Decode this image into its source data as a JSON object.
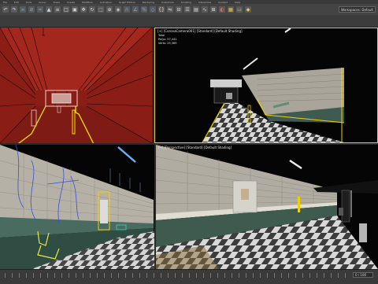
{
  "menu": {
    "items": [
      "File",
      "Edit",
      "Tools",
      "Group",
      "Views",
      "Create",
      "Modifiers",
      "Animation",
      "Graph Editors",
      "Rendering",
      "Customize",
      "Scripting",
      "Interactive",
      "Content",
      "Help"
    ]
  },
  "toolbar": {
    "icons": [
      {
        "name": "undo-icon",
        "glyph": "↶",
        "tone": "plain"
      },
      {
        "name": "redo-icon",
        "glyph": "↷",
        "tone": "plain"
      },
      {
        "name": "link-icon",
        "glyph": "∞",
        "tone": "blue"
      },
      {
        "name": "unlink-icon",
        "glyph": "⊘",
        "tone": "blue"
      },
      {
        "name": "bind-icon",
        "glyph": "≈",
        "tone": "blue"
      },
      {
        "name": "select-icon",
        "glyph": "▲",
        "tone": "plain"
      },
      {
        "name": "select-by-name-icon",
        "glyph": "≡",
        "tone": "plain"
      },
      {
        "name": "rect-select-icon",
        "glyph": "□",
        "tone": "plain"
      },
      {
        "name": "window-crossing-icon",
        "glyph": "▣",
        "tone": "plain"
      },
      {
        "name": "move-icon",
        "glyph": "✥",
        "tone": "plain"
      },
      {
        "name": "rotate-icon",
        "glyph": "↻",
        "tone": "plain"
      },
      {
        "name": "scale-icon",
        "glyph": "⬚",
        "tone": "plain"
      },
      {
        "name": "place-icon",
        "glyph": "⊕",
        "tone": "plain"
      },
      {
        "name": "pivot-icon",
        "glyph": "◈",
        "tone": "plain"
      },
      {
        "name": "snap-icon",
        "glyph": "∩",
        "tone": "blue"
      },
      {
        "name": "angle-snap-icon",
        "glyph": "∠",
        "tone": "blue"
      },
      {
        "name": "percent-snap-icon",
        "glyph": "%",
        "tone": "blue"
      },
      {
        "name": "spinner-snap-icon",
        "glyph": "◇",
        "tone": "blue"
      },
      {
        "name": "named-selection-icon",
        "glyph": "{}",
        "tone": "plain"
      },
      {
        "name": "mirror-icon",
        "glyph": "⇋",
        "tone": "plain"
      },
      {
        "name": "align-icon",
        "glyph": "⊟",
        "tone": "plain"
      },
      {
        "name": "layer-icon",
        "glyph": "☰",
        "tone": "plain"
      },
      {
        "name": "scene-explorer-icon",
        "glyph": "▤",
        "tone": "plain"
      },
      {
        "name": "curve-editor-icon",
        "glyph": "∿",
        "tone": "plain"
      },
      {
        "name": "schematic-view-icon",
        "glyph": "⊞",
        "tone": "plain"
      },
      {
        "name": "material-editor-icon",
        "glyph": "◐",
        "tone": "red"
      },
      {
        "name": "render-setup-icon",
        "glyph": "▦",
        "tone": "yellow"
      },
      {
        "name": "rendered-frame-icon",
        "glyph": "▭",
        "tone": "yellow"
      },
      {
        "name": "render-icon",
        "glyph": "◆",
        "tone": "yellow"
      }
    ],
    "workspace_dropdown": "Workspaces: Default"
  },
  "viewports": {
    "top_left": {
      "label": ""
    },
    "top_right": {
      "label": "[+] [CoronaCamera001] [Standard] [Default Shading]",
      "stats": [
        "Total",
        "Polys: 57,441",
        "Verts: 29,369"
      ]
    },
    "bottom_left": {
      "label": ""
    },
    "bottom_right": {
      "label": "[+] [Perspective] [Standard] [Default Shading]"
    }
  },
  "timeline": {
    "frame": "0 / 100"
  }
}
